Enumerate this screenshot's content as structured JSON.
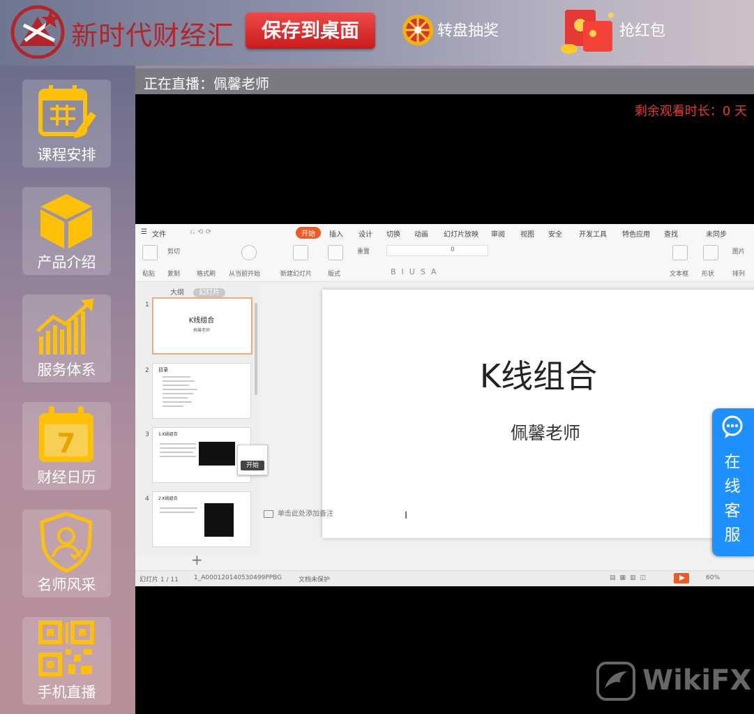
{
  "header": {
    "brand": "新时代财经汇",
    "save_label": "保存到桌面",
    "wheel_label": "转盘抽奖",
    "hongbao_label": "抢红包",
    "colors": {
      "brand_red": "#b3252a",
      "save_red": "#e03030"
    }
  },
  "sidebar": {
    "items": [
      {
        "label": "课程安排",
        "icon": "calendar-pencil-icon"
      },
      {
        "label": "产品介绍",
        "icon": "box-icon"
      },
      {
        "label": "服务体系",
        "icon": "growth-chart-icon"
      },
      {
        "label": "财经日历",
        "icon": "calendar-7-icon"
      },
      {
        "label": "名师风采",
        "icon": "teacher-shield-icon"
      },
      {
        "label": "手机直播",
        "icon": "qr-code-icon"
      }
    ],
    "icon_color": "#ffc107"
  },
  "live": {
    "title": "正在直播：佩馨老师",
    "remaining": "剩余观看时长：0 天"
  },
  "ppt": {
    "tabs": [
      "文件",
      "开始",
      "插入",
      "设计",
      "切换",
      "动画",
      "幻灯片放映",
      "审阅",
      "视图",
      "安全",
      "开发工具",
      "特色应用",
      "查找",
      "未同步"
    ],
    "active_tab": "开始",
    "ribbon_labels": [
      "粘贴",
      "剪切",
      "复制",
      "格式刷",
      "从当前开始",
      "新建幻灯片",
      "版式",
      "重置",
      "文本框",
      "形状",
      "排列",
      "图片"
    ],
    "font_size": "0",
    "panel_tabs": {
      "outline": "大纲",
      "slides": "幻灯片"
    },
    "thumbnails": [
      {
        "num": "1",
        "title": "K线组合",
        "sub": "佩馨老师"
      },
      {
        "num": "2",
        "title": "目录"
      },
      {
        "num": "3",
        "title": "1.K线组合"
      },
      {
        "num": "4",
        "title": "2.K线组合"
      }
    ],
    "popover_button": "开始",
    "notes_placeholder": "单击此处添加备注",
    "slide_title": "K线组合",
    "slide_subtitle": "佩馨老师",
    "status": {
      "slide_count": "幻灯片 1 / 11",
      "file_name": "1_A0001201405304​99PPBG",
      "protect": "文档未保护",
      "zoom": "60%"
    }
  },
  "kefu": {
    "label": "在线客服"
  },
  "watermark": "WikiFX"
}
